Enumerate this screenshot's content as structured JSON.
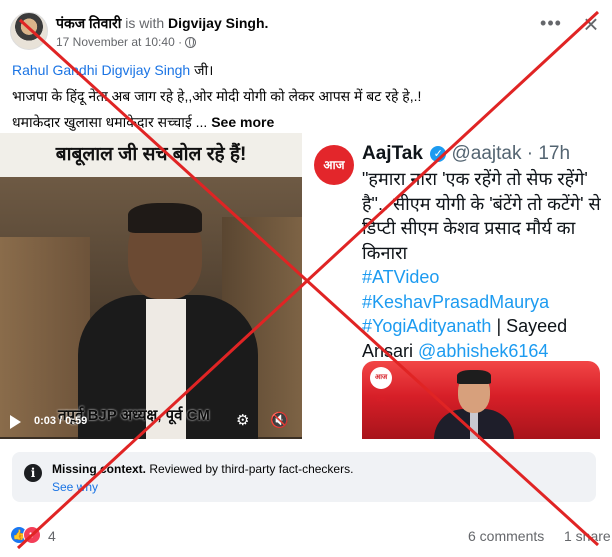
{
  "post": {
    "author": "पंकज तिवारी",
    "with_text": "is with",
    "tagged": "Digvijay Singh.",
    "timestamp": "17 November at 10:40 ·",
    "body_line1_tag": "Rahul Gandhi Digvijay Singh",
    "body_line1_rest": " जी।",
    "body_line2": "भाजपा के हिंदू  नेता अब जाग रहे हे,,ओर मोदी योगी  को लेकर आपस में बट रहे हे,.!",
    "body_line3": "धमाकेदार खुलासा धमाकेदार सच्चाई ... ",
    "see_more": "See more"
  },
  "video": {
    "banner": "बाबूलाल जी सच बोल रहे हैं!",
    "lower_third": "तपूर्व BJP अध्यक्ष, पूर्व CM",
    "time": "0:03 / 0:59"
  },
  "tweet": {
    "logo": "आज तक",
    "account": "AajTak",
    "handle": "@aajtak · 17h",
    "text": "\"हमारा नारा 'एक रहेंगे तो सेफ रहेंगे' है\".. सीएम योगी के 'बंटेंगे तो कटेंगे' से डिप्टी सीएम केशव प्रसाद मौर्य का किनारा",
    "hashtag1": "#ATVideo",
    "hashtag2": "#KeshavPrasadMaurya",
    "hashtag3": "#YogiAdityanath",
    "credit_sep": " | Sayeed",
    "credit_name": "Ansari ",
    "credit_handle": "@abhishek6164",
    "image_logo": "आज तक"
  },
  "context": {
    "label": "Missing context.",
    "text": " Reviewed by third-party fact-checkers.",
    "link": "See why"
  },
  "footer": {
    "reactions": "4",
    "comments": "6 comments",
    "shares": "1 share"
  },
  "colors": {
    "link_blue": "#1b74e4",
    "cross_red": "#e02424",
    "aajtak_red": "#e3262b"
  },
  "icons": [
    "globe-icon",
    "more-options-icon",
    "close-icon",
    "play-icon",
    "settings-icon",
    "volume-icon",
    "verified-icon",
    "info-icon",
    "like-icon",
    "love-icon"
  ]
}
